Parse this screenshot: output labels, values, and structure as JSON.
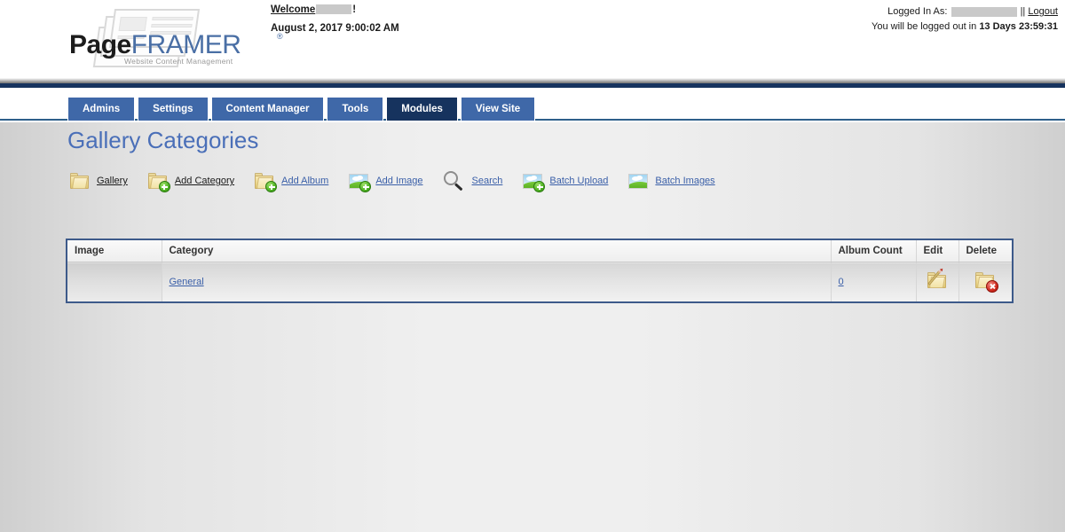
{
  "brand": {
    "logo_text_1": "Page",
    "logo_text_2": "FRAMER",
    "logo_registered": "®",
    "tagline": "Website Content Management"
  },
  "header": {
    "welcome_label": "Welcome",
    "welcome_suffix": "!",
    "welcome_user_redacted": true,
    "datetime": "August 2, 2017 9:00:02 AM",
    "logged_in_label": "Logged In As:",
    "logged_in_user_redacted": true,
    "separator": "||",
    "logout_label": "Logout",
    "logout_notice_prefix": "You will be logged out in",
    "logout_countdown": "13 Days 23:59:31"
  },
  "nav": {
    "tabs": [
      {
        "label": "Admins",
        "active": false
      },
      {
        "label": "Settings",
        "active": false
      },
      {
        "label": "Content Manager",
        "active": false
      },
      {
        "label": "Tools",
        "active": false
      },
      {
        "label": "Modules",
        "active": true
      },
      {
        "label": "View Site",
        "active": false
      }
    ]
  },
  "page": {
    "title": "Gallery Categories"
  },
  "toolbar": {
    "items": [
      {
        "label": "Gallery",
        "icon": "folder-icon"
      },
      {
        "label": "Add Category",
        "icon": "folder-add-icon"
      },
      {
        "label": "Add Album",
        "icon": "folder-add-icon"
      },
      {
        "label": "Add Image",
        "icon": "image-add-icon"
      },
      {
        "label": "Search",
        "icon": "magnifier-icon"
      },
      {
        "label": "Batch Upload",
        "icon": "image-add-icon"
      },
      {
        "label": "Batch Images",
        "icon": "image-icon"
      }
    ]
  },
  "table": {
    "columns": [
      "Image",
      "Category",
      "Album Count",
      "Edit",
      "Delete"
    ],
    "rows": [
      {
        "image": "",
        "category": "General",
        "album_count": "0",
        "edit_icon": "folder-edit-icon",
        "delete_icon": "folder-delete-icon"
      }
    ]
  },
  "colors": {
    "tab_inactive": "#3f68a8",
    "tab_active": "#16335e",
    "title_blue": "#4a6fb8",
    "link_blue": "#3a5fa8",
    "table_border": "#3d5a8a",
    "navy_bar": "#16335e"
  }
}
